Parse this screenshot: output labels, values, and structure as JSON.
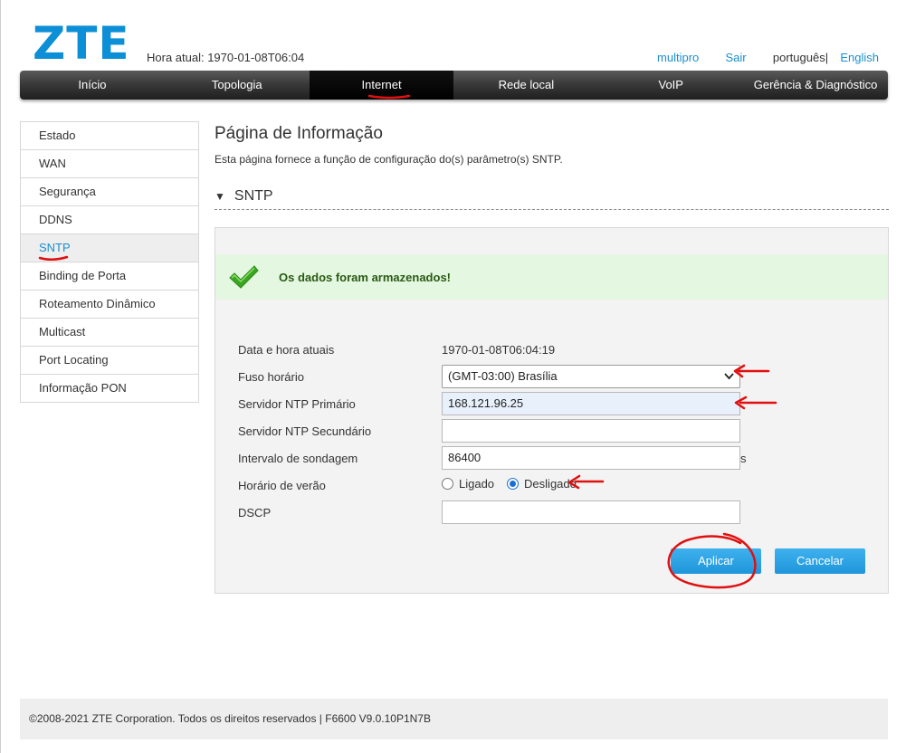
{
  "header": {
    "logo": "ZTE",
    "hora_label": "Hora atual: 1970-01-08T06:04",
    "user_link": "multipro",
    "logout_link": "Sair",
    "lang_current": "português",
    "lang_sep": "|",
    "lang_other": "English"
  },
  "nav": {
    "items": [
      "Início",
      "Topologia",
      "Internet",
      "Rede local",
      "VoIP",
      "Gerência & Diagnóstico"
    ],
    "active_index": 2
  },
  "sidebar": {
    "items": [
      "Estado",
      "WAN",
      "Segurança",
      "DDNS",
      "SNTP",
      "Binding de Porta",
      "Roteamento Dinâmico",
      "Multicast",
      "Port Locating",
      "Informação PON"
    ],
    "active_index": 4
  },
  "main": {
    "title": "Página de Informação",
    "description": "Esta página fornece a função de configuração do(s) parâmetro(s) SNTP.",
    "section_title": "SNTP",
    "success_message": "Os dados foram armazenados!",
    "form": {
      "datetime_label": "Data e hora atuais",
      "datetime_value": "1970-01-08T06:04:19",
      "timezone_label": "Fuso horário",
      "timezone_value": "(GMT-03:00) Brasília",
      "ntp_primary_label": "Servidor NTP Primário",
      "ntp_primary_value": "168.121.96.25",
      "ntp_secondary_label": "Servidor NTP Secundário",
      "ntp_secondary_value": "",
      "interval_label": "Intervalo de sondagem",
      "interval_value": "86400",
      "interval_unit": "s",
      "dst_label": "Horário de verão",
      "dst_on_label": "Ligado",
      "dst_off_label": "Desligado",
      "dst_selected": "Desligado",
      "dscp_label": "DSCP",
      "dscp_value": ""
    },
    "apply_button": "Aplicar",
    "cancel_button": "Cancelar"
  },
  "footer": {
    "text": "©2008-2021 ZTE Corporation. Todos os direitos reservados  |   F6600 V9.0.10P1N7B"
  },
  "colors": {
    "accent": "#1a8fcf",
    "logo": "#0c8fd6",
    "button": "#1e96db",
    "success_bg": "#e4f7e0",
    "annotation": "#e01010"
  }
}
